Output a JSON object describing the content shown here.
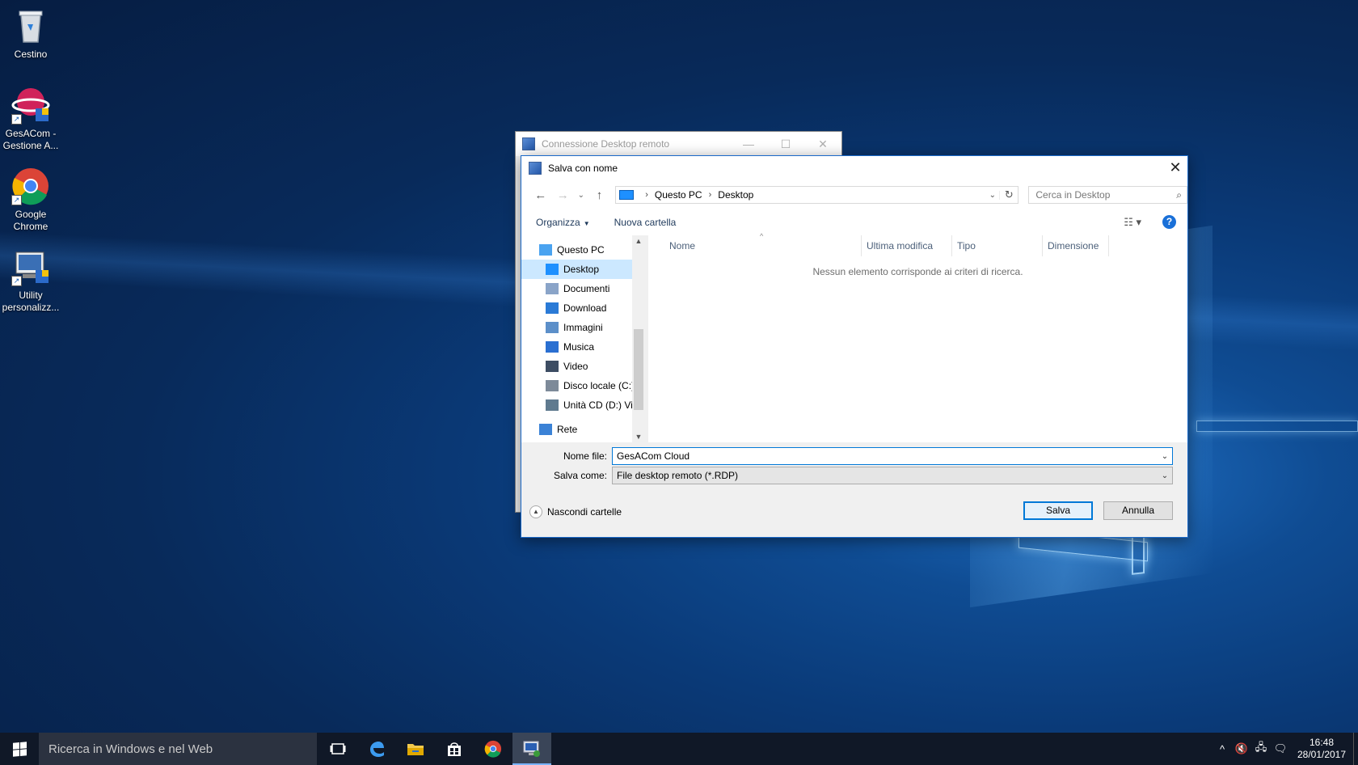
{
  "desktop": {
    "icons": [
      {
        "label_line1": "Cestino",
        "label_line2": ""
      },
      {
        "label_line1": "GesACom -",
        "label_line2": "Gestione A..."
      },
      {
        "label_line1": "Google",
        "label_line2": "Chrome"
      },
      {
        "label_line1": "Utility",
        "label_line2": "personalizz..."
      }
    ]
  },
  "rdp_window": {
    "title": "Connessione Desktop remoto",
    "minimize": "—",
    "maximize": "☐",
    "close": "✕"
  },
  "dialog": {
    "title": "Salva con nome",
    "close": "✕",
    "nav": {
      "back": "←",
      "forward": "→",
      "recent": "⌄",
      "up": "↑",
      "breadcrumbs": [
        "Questo PC",
        "Desktop"
      ],
      "separator": "›",
      "dropdown": "⌄",
      "refresh": "↻",
      "search_placeholder": "Cerca in Desktop"
    },
    "toolbar": {
      "organize": "Organizza",
      "new_folder": "Nuova cartella",
      "help": "?"
    },
    "tree": [
      {
        "label": "Questo PC",
        "level": 1,
        "selected": false,
        "icon": "pc-icon",
        "color": "#4aa3f0"
      },
      {
        "label": "Desktop",
        "level": 2,
        "selected": true,
        "icon": "desktop-icon",
        "color": "#1e90ff"
      },
      {
        "label": "Documenti",
        "level": 2,
        "selected": false,
        "icon": "documents-icon",
        "color": "#8aa4c8"
      },
      {
        "label": "Download",
        "level": 2,
        "selected": false,
        "icon": "download-icon",
        "color": "#2a7ad6"
      },
      {
        "label": "Immagini",
        "level": 2,
        "selected": false,
        "icon": "pictures-icon",
        "color": "#5c8fc9"
      },
      {
        "label": "Musica",
        "level": 2,
        "selected": false,
        "icon": "music-icon",
        "color": "#2a6fd1"
      },
      {
        "label": "Video",
        "level": 2,
        "selected": false,
        "icon": "video-icon",
        "color": "#3d4d63"
      },
      {
        "label": "Disco locale (C:)",
        "level": 2,
        "selected": false,
        "icon": "drive-icon",
        "color": "#7d8a99"
      },
      {
        "label": "Unità CD (D:) Vir",
        "level": 2,
        "selected": false,
        "icon": "cd-drive-icon",
        "color": "#5f7a8f"
      },
      {
        "label": "Rete",
        "level": 1,
        "selected": false,
        "icon": "network-icon",
        "color": "#3b82d6"
      }
    ],
    "columns": [
      "Nome",
      "Ultima modifica",
      "Tipo",
      "Dimensione"
    ],
    "empty_message": "Nessun elemento corrisponde ai criteri di ricerca.",
    "filename_label": "Nome file:",
    "filename_value": "GesACom Cloud",
    "savetype_label": "Salva come:",
    "savetype_value": "File desktop remoto (*.RDP)",
    "hide_folders": "Nascondi cartelle",
    "save_button": "Salva",
    "cancel_button": "Annulla"
  },
  "taskbar": {
    "search_text": "Ricerca in Windows e nel Web",
    "time": "16:48",
    "date": "28/01/2017"
  },
  "colors": {
    "accent": "#0078d7",
    "selection": "#cce8ff",
    "taskbar": "#101827"
  }
}
